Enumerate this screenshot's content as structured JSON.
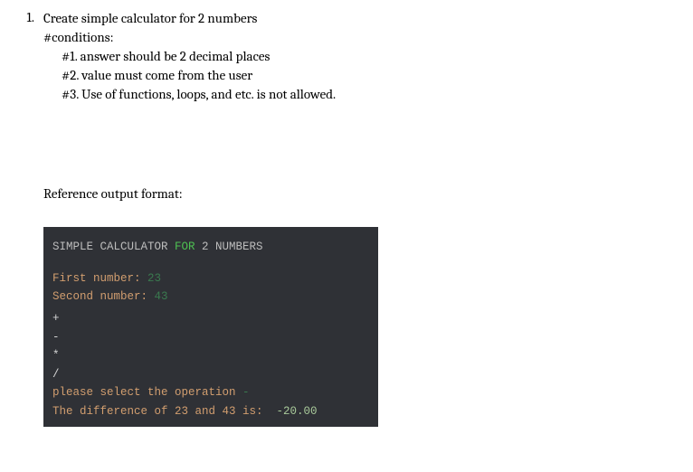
{
  "list": {
    "number": "1.",
    "title": "Create simple calculator for 2 numbers",
    "conditions_label": "#conditions:",
    "conditions": [
      "#1. answer should be 2 decimal places",
      "#2. value must come from the user",
      "#3. Use of functions, loops, and etc. is not allowed."
    ],
    "reference_label": "Reference output format:"
  },
  "terminal": {
    "title_pre": "SIMPLE CALCULATOR ",
    "title_kw": "FOR",
    "title_post": " 2 NUMBERS",
    "first_label": "First number: ",
    "first_value": "23",
    "second_label": "Second number: ",
    "second_value": "43",
    "ops": [
      "+",
      "-",
      "*",
      "/"
    ],
    "select_label": "please select the operation ",
    "select_op": "-",
    "result_label": "The difference of 23 and 43 is:  ",
    "result_value": "-20.00"
  }
}
